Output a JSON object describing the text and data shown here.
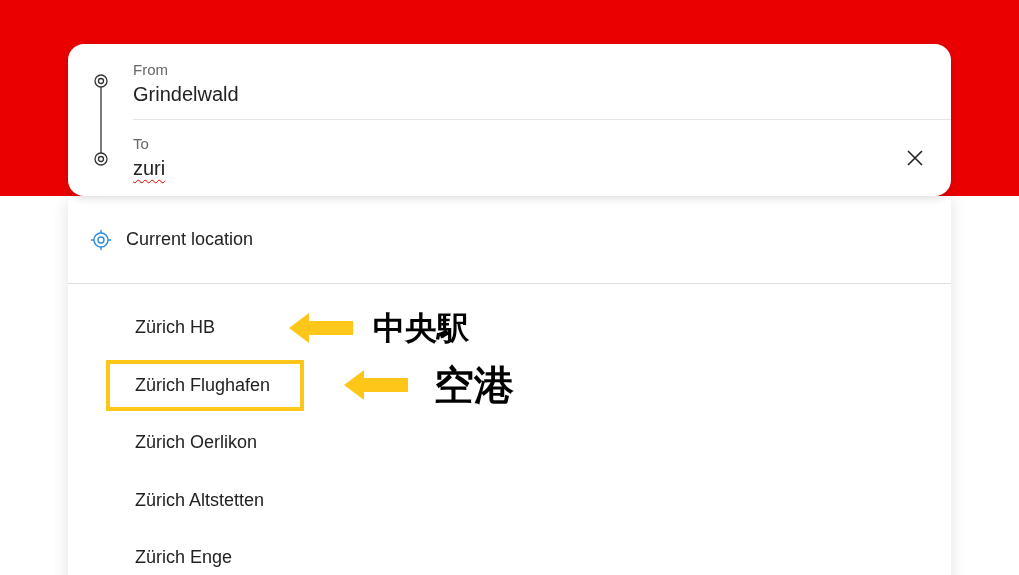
{
  "route": {
    "from": {
      "label": "From",
      "value": "Grindelwald"
    },
    "to": {
      "label": "To",
      "value": "zuri",
      "misspelled": true
    }
  },
  "current_location": "Current location",
  "suggestions": [
    {
      "name": "Zürich HB",
      "highlighted": false,
      "note": "中央駅"
    },
    {
      "name": "Zürich Flughafen",
      "highlighted": true,
      "note": "空港"
    },
    {
      "name": "Zürich Oerlikon",
      "highlighted": false
    },
    {
      "name": "Zürich Altstetten",
      "highlighted": false
    },
    {
      "name": "Zürich Enge",
      "highlighted": false
    }
  ]
}
